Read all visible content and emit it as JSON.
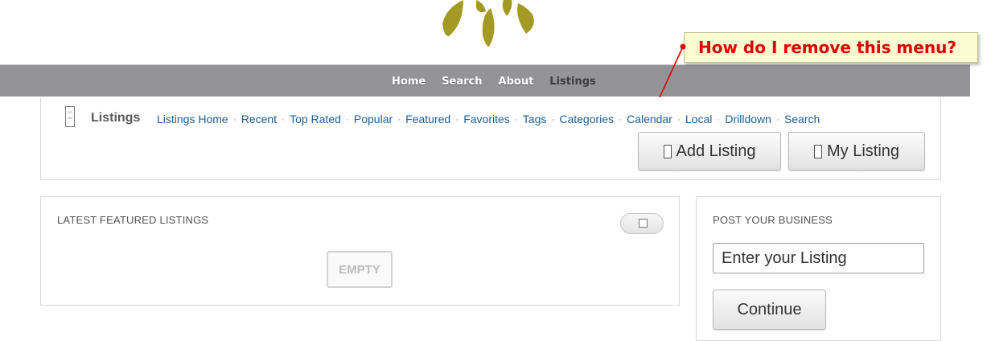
{
  "colors": {
    "navbar": "#939398",
    "link": "#1a5fa0",
    "callout_bg": "#fdfbd2",
    "callout_text": "#e00000",
    "leaf": "#a29a24"
  },
  "nav": {
    "items": [
      {
        "label": "Home"
      },
      {
        "label": "Search"
      },
      {
        "label": "About"
      },
      {
        "label": "Listings"
      }
    ]
  },
  "annotation": {
    "text": "How do I remove this menu?"
  },
  "listings_menu": {
    "icon": "plugin-logo-icon",
    "title": "Listings",
    "links": [
      "Listings Home",
      "Recent",
      "Top Rated",
      "Popular",
      "Featured",
      "Favorites",
      "Tags",
      "Categories",
      "Calendar",
      "Local",
      "Drilldown",
      "Search"
    ],
    "add_listing_label": "Add Listing",
    "my_listing_label": "My Listing"
  },
  "featured": {
    "title": "LATEST FEATURED LISTINGS",
    "empty_label": "EMPTY",
    "toggle_icon": "rss-icon"
  },
  "post_business": {
    "title": "POST YOUR BUSINESS",
    "input_placeholder": "Enter your Listing",
    "continue_label": "Continue"
  }
}
